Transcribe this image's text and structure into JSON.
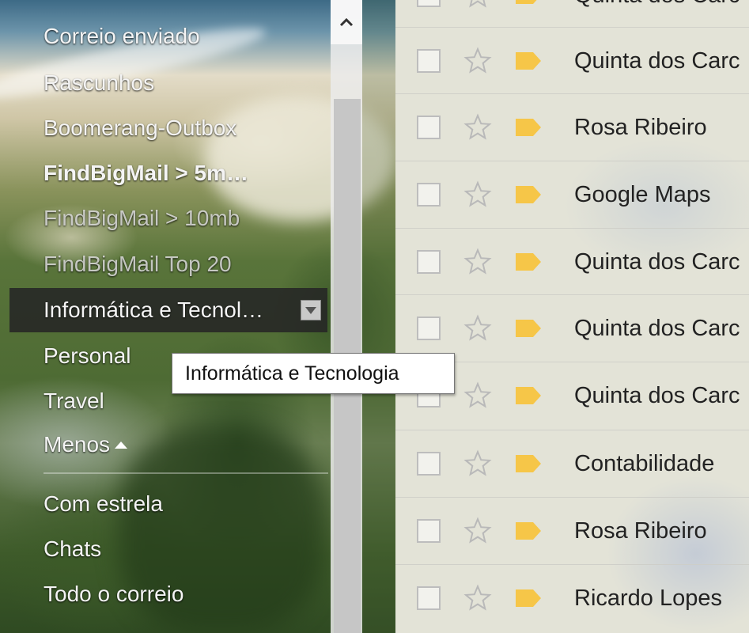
{
  "sidebar": {
    "items": [
      {
        "label": "Correio enviado",
        "style": "normal"
      },
      {
        "label": "Rascunhos",
        "style": "normal"
      },
      {
        "label": "Boomerang-Outbox",
        "style": "normal"
      },
      {
        "label": "FindBigMail > 5m…",
        "style": "bold"
      },
      {
        "label": "FindBigMail > 10mb",
        "style": "dim"
      },
      {
        "label": "FindBigMail Top 20",
        "style": "dim"
      },
      {
        "label": "Informática e Tecnol…",
        "style": "active"
      },
      {
        "label": "Personal",
        "style": "normal"
      },
      {
        "label": "Travel",
        "style": "normal"
      },
      {
        "label": "Menos",
        "style": "normal"
      },
      {
        "label": "Com estrela",
        "style": "normal"
      },
      {
        "label": "Chats",
        "style": "normal"
      },
      {
        "label": "Todo o correio",
        "style": "normal"
      }
    ]
  },
  "tooltip": {
    "text": "Informática e Tecnologia"
  },
  "messages": [
    {
      "sender": "Quinta dos Carc",
      "partial_top": true
    },
    {
      "sender": "Quinta dos Carc"
    },
    {
      "sender": "Rosa Ribeiro"
    },
    {
      "sender": "Google Maps"
    },
    {
      "sender": "Quinta dos Carc"
    },
    {
      "sender": "Quinta dos Carc"
    },
    {
      "sender": "Quinta dos Carc"
    },
    {
      "sender": "Contabilidade"
    },
    {
      "sender": "Rosa Ribeiro"
    },
    {
      "sender": "Ricardo Lopes"
    }
  ],
  "colors": {
    "label_tag": "#f6c648",
    "star_outline": "#b9b9b9",
    "active_item_bg": "#262626"
  },
  "icons": {
    "star": "star-outline-icon",
    "label": "label-tag-icon",
    "scroll_up": "chevron-up-icon",
    "dropdown": "dropdown-arrow-icon",
    "collapse": "triangle-up-icon"
  }
}
